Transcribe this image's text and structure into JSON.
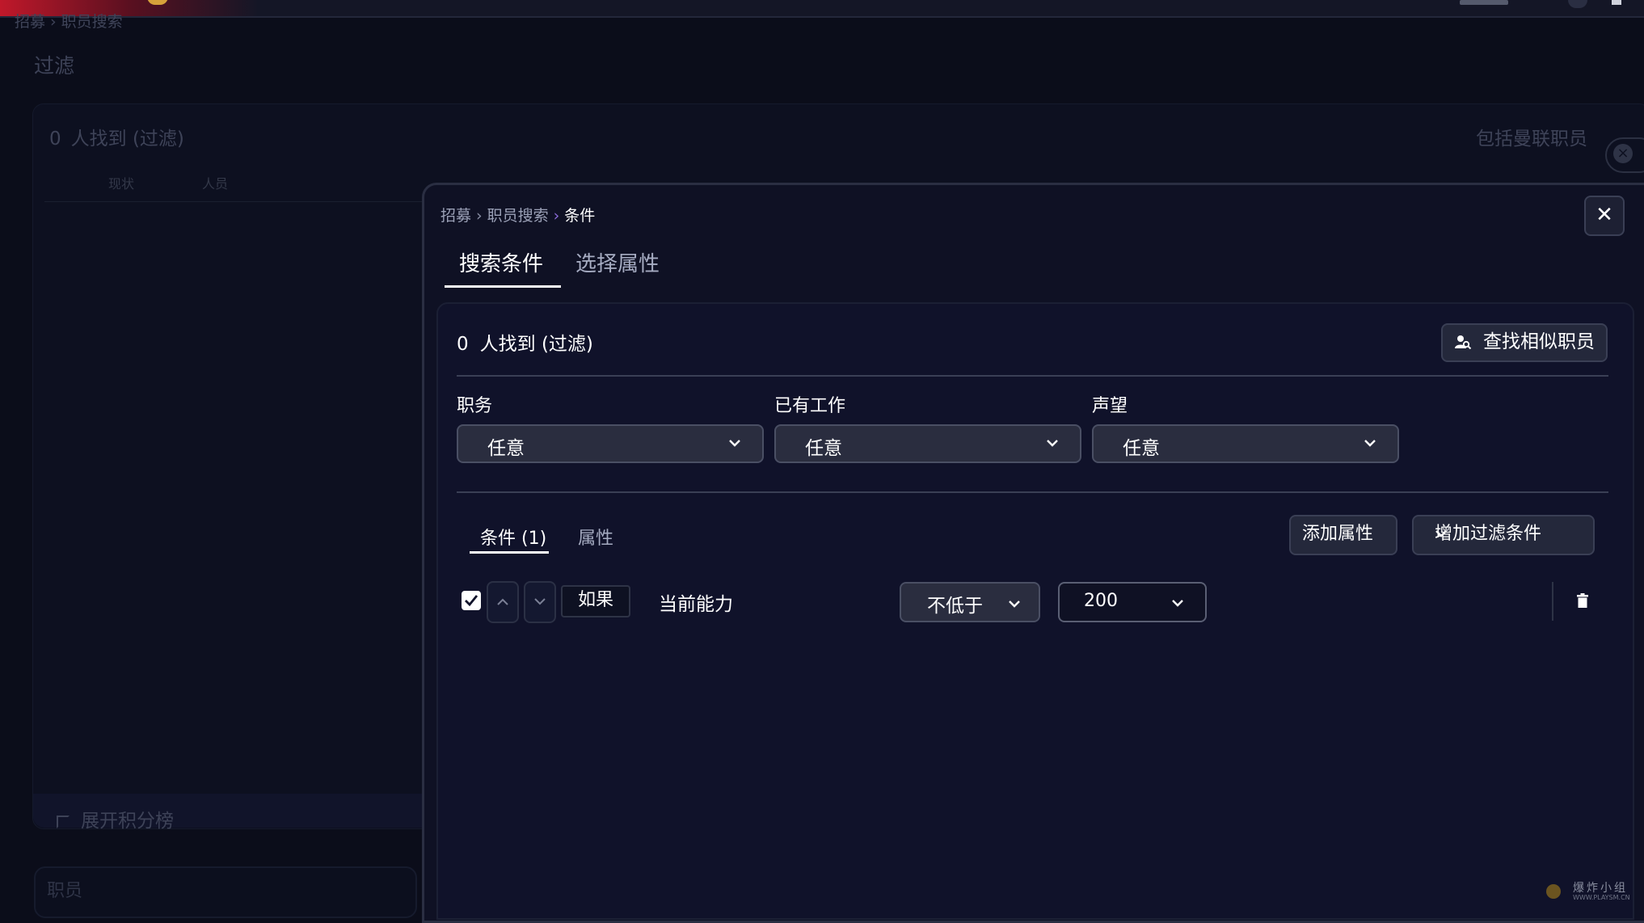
{
  "background": {
    "breadcrumb": [
      "招募",
      "职员搜索"
    ],
    "title": "过滤",
    "count_number": "0",
    "count_text": "人找到 (过滤)",
    "columns": [
      "现状",
      "人员"
    ],
    "include_label": "包括曼联职员",
    "expand_label": "展开积分榜",
    "staff_label": "职员"
  },
  "modal": {
    "breadcrumb": [
      "招募",
      "职员搜索",
      "条件"
    ],
    "tabs": [
      "搜索条件",
      "选择属性"
    ],
    "count_number": "0",
    "count_text": "人找到 (过滤)",
    "find_similar_label": "查找相似职员",
    "filters": [
      {
        "label": "职务",
        "value": "任意"
      },
      {
        "label": "已有工作",
        "value": "任意"
      },
      {
        "label": "声望",
        "value": "任意"
      }
    ],
    "subtabs": [
      "条件 (1)",
      "属性"
    ],
    "add_attribute_label": "添加属性",
    "add_filter_label": "增加过滤条件",
    "condition": {
      "checked": true,
      "if_label": "如果",
      "attribute": "当前能力",
      "operator": "不低于",
      "value": "200"
    }
  },
  "watermark": {
    "text": "爆炸小组",
    "sub": "WWW.PLAYSM.CN"
  },
  "icons": {
    "close": "close-icon",
    "search_person": "person-search-icon",
    "chevron": "chevron-down-icon",
    "up": "chevron-up-icon",
    "trash": "trash-icon",
    "check": "check-icon"
  }
}
